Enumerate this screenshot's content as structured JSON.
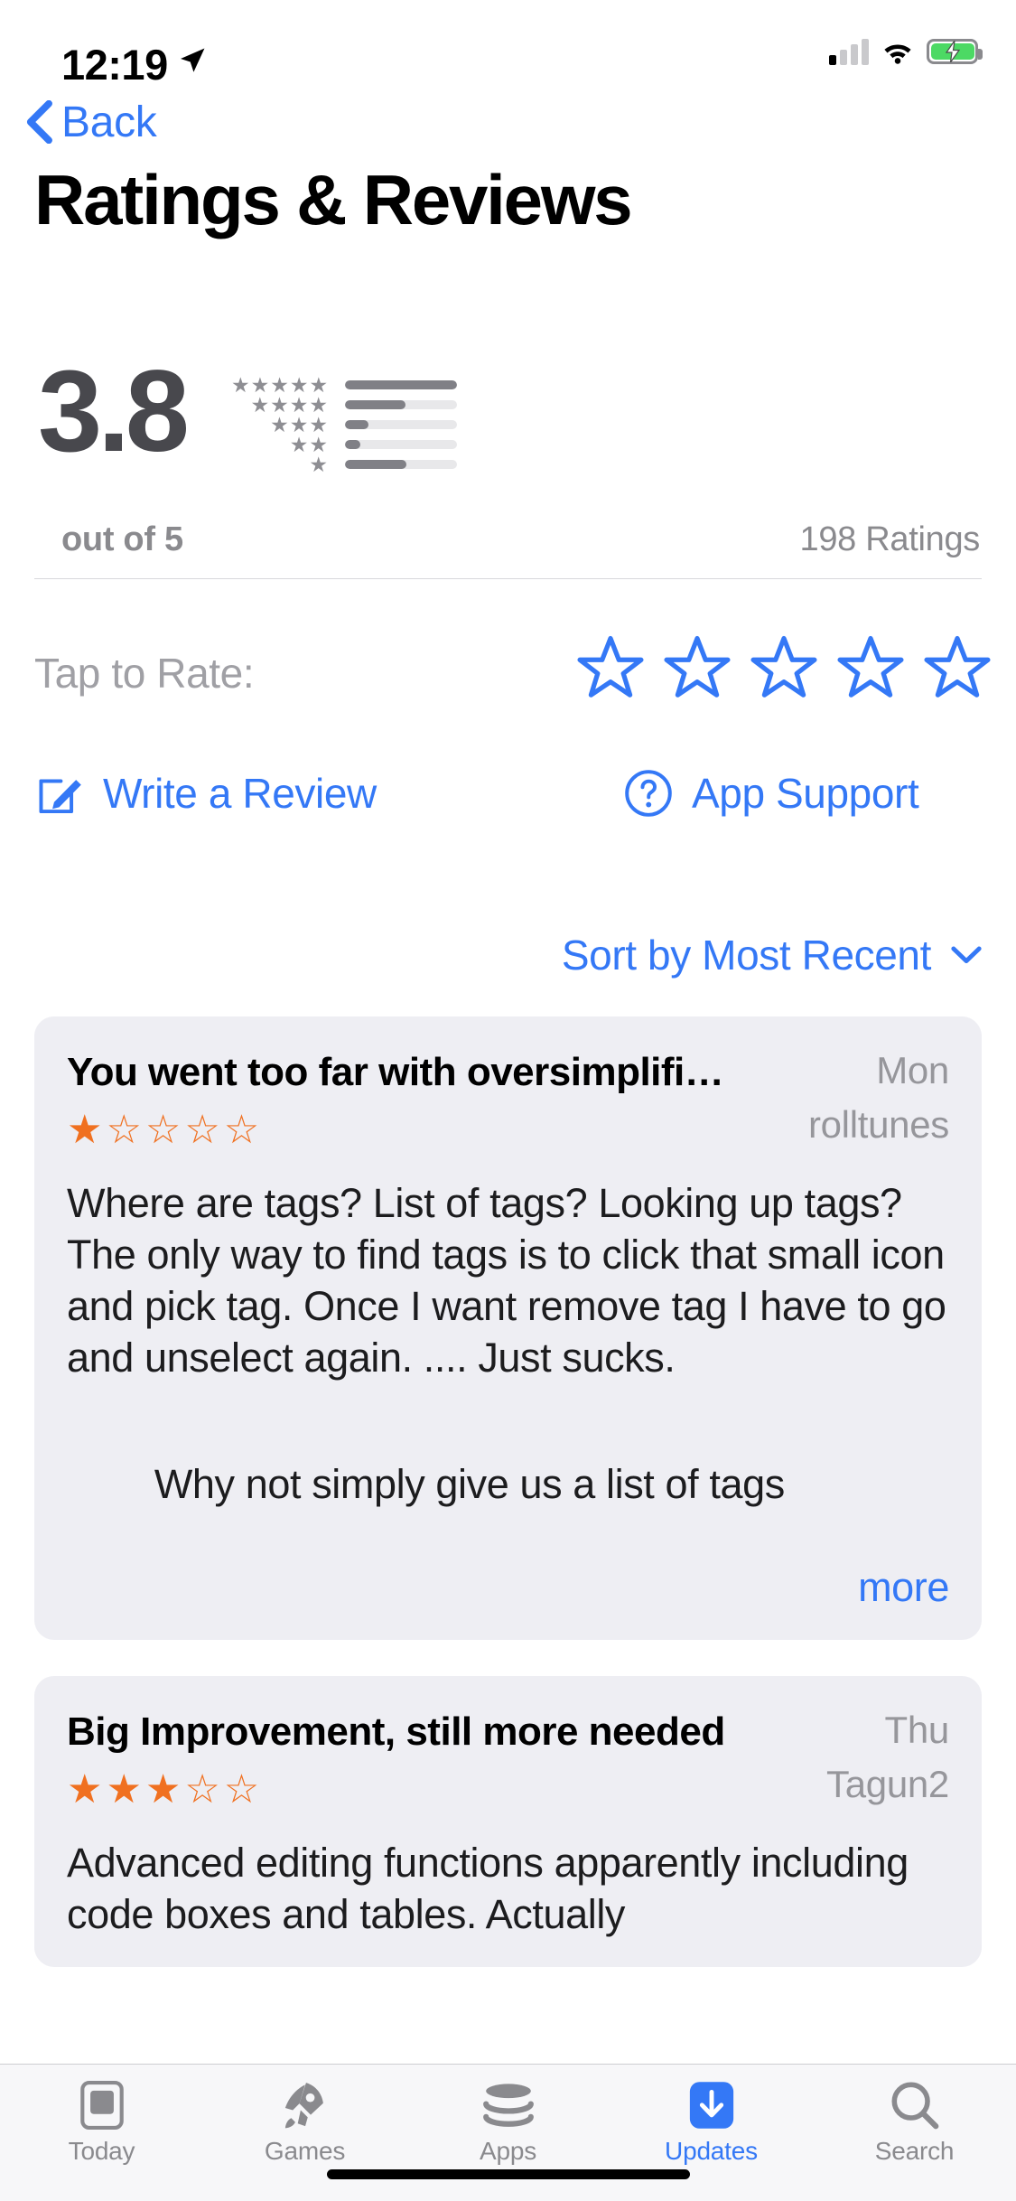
{
  "status_bar": {
    "time": "12:19",
    "location_icon": "location-arrow-icon",
    "signal_icon": "cellular-signal-icon",
    "signal_bars_filled": 1,
    "wifi_icon": "wifi-icon",
    "battery_icon": "battery-charging-icon",
    "battery_color": "#4cd964"
  },
  "nav": {
    "back_label": "Back",
    "back_icon": "chevron-left-icon",
    "accent_color": "#3478f6"
  },
  "header": {
    "title": "Ratings & Reviews"
  },
  "summary": {
    "score": "3.8",
    "out_of_label": "out of 5",
    "ratings_count_label": "198 Ratings"
  },
  "chart_data": {
    "type": "bar",
    "title": "Rating distribution",
    "orientation": "horizontal",
    "categories": [
      "★★★★★",
      "★★★★",
      "★★★",
      "★★",
      "★"
    ],
    "category_labels": [
      "5 stars",
      "4 stars",
      "3 stars",
      "2 stars",
      "1 star"
    ],
    "values": [
      100,
      54,
      21,
      14,
      55
    ],
    "value_unit": "percent of ratings",
    "xlabel": "",
    "ylabel": "",
    "xlim": [
      0,
      100
    ],
    "grid": false,
    "legend": false,
    "average": 3.8,
    "total_ratings": 198,
    "bar_fill_color": "#808086",
    "bar_track_color": "#e8e8ea",
    "star_color": "#8e8e93"
  },
  "tap_to_rate": {
    "label": "Tap to Rate:",
    "star_count": 5,
    "stars_filled": 0,
    "star_icon": "star-outline-icon",
    "star_color": "#3478f6"
  },
  "actions": {
    "write_review": {
      "label": "Write a Review",
      "icon": "compose-pencil-icon"
    },
    "app_support": {
      "label": "App Support",
      "icon": "question-circle-icon"
    }
  },
  "sort": {
    "label": "Sort by Most Recent",
    "icon": "chevron-down-icon"
  },
  "reviews": [
    {
      "title": "You went too far with oversimplifi…",
      "date": "Mon",
      "user": "rolltunes",
      "rating": 1,
      "stars_display": "★☆☆☆☆",
      "body": "Where are tags? List of tags? Looking up tags? The only way to find tags is to click that small icon and pick tag. Once I want remove tag I have to go and unselect again. .... Just sucks.",
      "body_tail": "Why not simply give us a list of tags",
      "more_label": "more"
    },
    {
      "title": "Big Improvement, still more needed",
      "date": "Thu",
      "user": "Tagun2",
      "rating": 3,
      "stars_display": "★★★☆☆",
      "body": "Advanced editing functions apparently including code boxes and tables. Actually"
    }
  ],
  "tab_bar": {
    "items": [
      {
        "label": "Today",
        "icon": "today-document-icon",
        "active": false
      },
      {
        "label": "Games",
        "icon": "rocket-icon",
        "active": false
      },
      {
        "label": "Apps",
        "icon": "stacked-layers-icon",
        "active": false
      },
      {
        "label": "Updates",
        "icon": "download-arrow-icon",
        "active": true
      },
      {
        "label": "Search",
        "icon": "magnifier-icon",
        "active": false
      }
    ],
    "active_color": "#3478f6",
    "inactive_color": "#8a8a8e"
  },
  "home_indicator": "home-bar"
}
